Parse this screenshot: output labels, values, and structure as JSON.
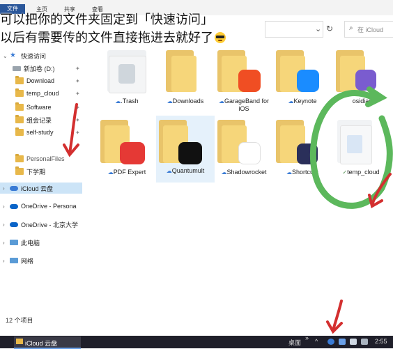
{
  "ribbon": {
    "tabs": [
      "文件",
      "主页",
      "共享",
      "查看"
    ]
  },
  "address": {
    "search_placeholder": "在 iCloud"
  },
  "caption": {
    "line1": "可以把你的文件夹固定到「快速访问」",
    "line2": "以后有需要传的文件直接拖进去就好了"
  },
  "sidebar": {
    "quick_access": "快速访问",
    "items": [
      {
        "label": "新加卷 (D:)"
      },
      {
        "label": "Download"
      },
      {
        "label": "temp_cloud"
      },
      {
        "label": "Software"
      },
      {
        "label": "组会记录"
      },
      {
        "label": "self-study"
      },
      {
        "label": "PersonalFiles"
      },
      {
        "label": "下学期"
      }
    ],
    "locations": [
      {
        "label": "iCloud 云盘"
      },
      {
        "label": "OneDrive - Persona"
      },
      {
        "label": "OneDrive - 北京大学"
      },
      {
        "label": "此电脑"
      },
      {
        "label": "网络"
      }
    ]
  },
  "files": [
    {
      "name": ".Trash"
    },
    {
      "name": "Downloads"
    },
    {
      "name": "GarageBand for iOS"
    },
    {
      "name": "Keynote"
    },
    {
      "name": "osidian"
    },
    {
      "name": "PDF Expert"
    },
    {
      "name": "Quantumult"
    },
    {
      "name": "Shadowrocket"
    },
    {
      "name": "Shortcuts"
    },
    {
      "name": "temp_cloud"
    }
  ],
  "status": {
    "count": "12 个项目"
  },
  "taskbar": {
    "app_label": "iCloud 云盘",
    "desktop": "桌面",
    "time": "2:55"
  },
  "colors": {
    "accent": "#2b579a",
    "selection": "#cce4f7",
    "annotation_green": "#4caf50",
    "annotation_red": "#d32f2f"
  }
}
